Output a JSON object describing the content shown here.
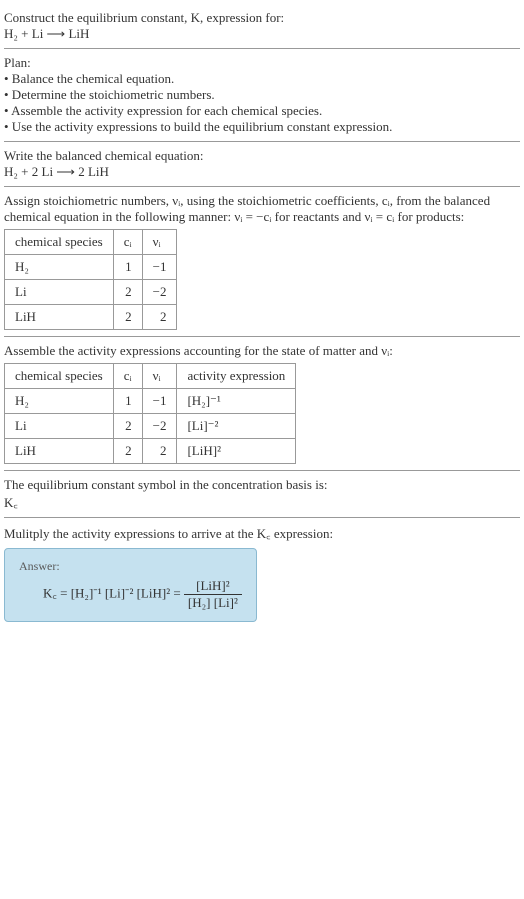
{
  "s1": {
    "line1": "Construct the equilibrium constant, K, expression for:",
    "line2": "H₂ + Li ⟶ LiH"
  },
  "s2": {
    "title": "Plan:",
    "b1": "• Balance the chemical equation.",
    "b2": "• Determine the stoichiometric numbers.",
    "b3": "• Assemble the activity expression for each chemical species.",
    "b4": "• Use the activity expressions to build the equilibrium constant expression."
  },
  "s3": {
    "line1": "Write the balanced chemical equation:",
    "line2": "H₂ + 2 Li ⟶ 2 LiH"
  },
  "s4": {
    "intro": "Assign stoichiometric numbers, νᵢ, using the stoichiometric coefficients, cᵢ, from the balanced chemical equation in the following manner: νᵢ = −cᵢ for reactants and νᵢ = cᵢ for products:",
    "h1": "chemical species",
    "h2": "cᵢ",
    "h3": "νᵢ",
    "r1c1": "H₂",
    "r1c2": "1",
    "r1c3": "−1",
    "r2c1": "Li",
    "r2c2": "2",
    "r2c3": "−2",
    "r3c1": "LiH",
    "r3c2": "2",
    "r3c3": "2"
  },
  "s5": {
    "intro": "Assemble the activity expressions accounting for the state of matter and νᵢ:",
    "h1": "chemical species",
    "h2": "cᵢ",
    "h3": "νᵢ",
    "h4": "activity expression",
    "r1c1": "H₂",
    "r1c2": "1",
    "r1c3": "−1",
    "r1c4": "[H₂]⁻¹",
    "r2c1": "Li",
    "r2c2": "2",
    "r2c3": "−2",
    "r2c4": "[Li]⁻²",
    "r3c1": "LiH",
    "r3c2": "2",
    "r3c3": "2",
    "r3c4": "[LiH]²"
  },
  "s6": {
    "line1": "The equilibrium constant symbol in the concentration basis is:",
    "line2": "K꜀"
  },
  "s7": {
    "intro": "Mulitply the activity expressions to arrive at the K꜀ expression:",
    "answer_label": "Answer:",
    "lhs": "K꜀ = [H₂]⁻¹ [Li]⁻² [LiH]² = ",
    "frac_top": "[LiH]²",
    "frac_bot": "[H₂] [Li]²"
  }
}
